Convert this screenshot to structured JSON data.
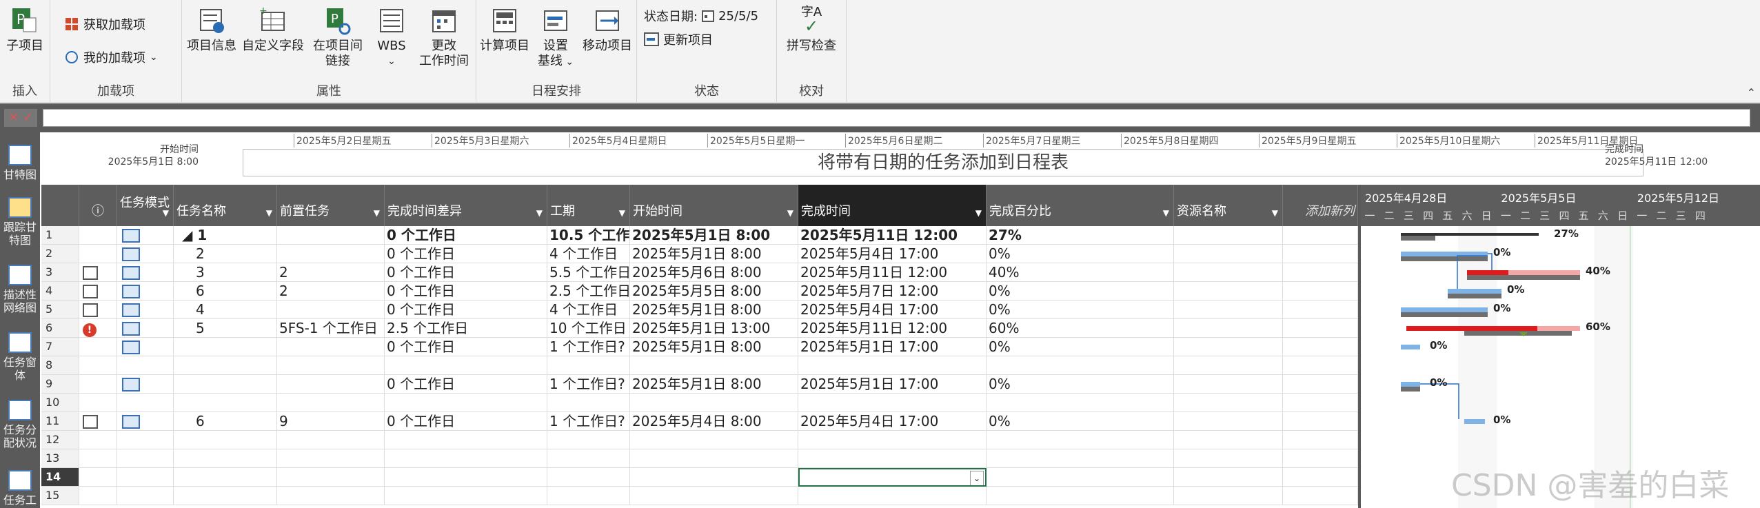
{
  "ribbon": {
    "groups": {
      "insert": {
        "label": "插入",
        "subproject": "子项目"
      },
      "addins": {
        "label": "加载项",
        "get_addins": "获取加载项",
        "my_addins": "我的加载项"
      },
      "properties": {
        "label": "属性",
        "project_info": "项目信息",
        "custom_fields": "自定义字段",
        "links_line1": "在项目间",
        "links_line2": "链接",
        "wbs": "WBS",
        "change_time_line1": "更改",
        "change_time_line2": "工作时间"
      },
      "schedule": {
        "label": "日程安排",
        "calc": "计算项目",
        "baseline_line1": "设置",
        "baseline_line2": "基线",
        "move": "移动项目"
      },
      "status": {
        "label": "状态",
        "status_date_label": "状态日期:",
        "status_date": "25/5/5",
        "update": "更新项目"
      },
      "proofing": {
        "label": "校对",
        "spell_top": "字A",
        "spell": "拼写检查"
      }
    }
  },
  "viewbar": {
    "items": [
      "甘特图",
      "跟踪甘特图",
      "描述性网络图",
      "任务窗体",
      "任务分配状况",
      "任务工"
    ]
  },
  "timeline": {
    "start_label": "开始时间",
    "start_value": "2025年5月1日 8:00",
    "finish_label": "完成时间",
    "finish_value": "2025年5月11日 12:00",
    "placeholder": "将带有日期的任务添加到日程表",
    "dates": [
      "2025年5月2日星期五",
      "2025年5月3日星期六",
      "2025年5月4日星期日",
      "2025年5月5日星期一",
      "2025年5月6日星期二",
      "2025年5月7日星期三",
      "2025年5月8日星期四",
      "2025年5月9日星期五",
      "2025年5月10日星期六",
      "2025年5月11日星期日"
    ]
  },
  "grid": {
    "headers": {
      "info": "ⓘ",
      "mode": "任务模式",
      "name": "任务名称",
      "pred": "前置任务",
      "slack": "完成时间差异",
      "duration": "工期",
      "start": "开始时间",
      "finish": "完成时间",
      "pct": "完成百分比",
      "resource": "资源名称",
      "add": "添加新列"
    },
    "rows": [
      {
        "no": "1",
        "ind": "",
        "name": "◢ 1",
        "pred": "",
        "slack": "0 个工作日",
        "dur": "10.5 个工作",
        "start": "2025年5月1日 8:00",
        "finish": "2025年5月11日 12:00",
        "pct": "27%",
        "bold": true
      },
      {
        "no": "2",
        "ind": "",
        "name": "2",
        "pred": "",
        "slack": "0 个工作日",
        "dur": "4 个工作日",
        "start": "2025年5月1日 8:00",
        "finish": "2025年5月4日 17:00",
        "pct": "0%"
      },
      {
        "no": "3",
        "ind": "cal",
        "name": "3",
        "pred": "2",
        "slack": "0 个工作日",
        "dur": "5.5 个工作日",
        "start": "2025年5月6日 8:00",
        "finish": "2025年5月11日 12:00",
        "pct": "40%"
      },
      {
        "no": "4",
        "ind": "cal",
        "name": "6",
        "pred": "2",
        "slack": "0 个工作日",
        "dur": "2.5 个工作日",
        "start": "2025年5月5日 8:00",
        "finish": "2025年5月7日 12:00",
        "pct": "0%"
      },
      {
        "no": "5",
        "ind": "cal",
        "name": "4",
        "pred": "",
        "slack": "0 个工作日",
        "dur": "4 个工作日",
        "start": "2025年5月1日 8:00",
        "finish": "2025年5月4日 17:00",
        "pct": "0%"
      },
      {
        "no": "6",
        "ind": "warn",
        "name": "5",
        "pred": "5FS-1 个工作日",
        "slack": "2.5 个工作日",
        "dur": "10 个工作日",
        "start": "2025年5月1日 13:00",
        "finish": "2025年5月11日 12:00",
        "pct": "60%"
      },
      {
        "no": "7",
        "ind": "",
        "name": "",
        "pred": "",
        "slack": "0 个工作日",
        "dur": "1 个工作日?",
        "start": "2025年5月1日 8:00",
        "finish": "2025年5月1日 17:00",
        "pct": "0%"
      },
      {
        "no": "8",
        "ind": "",
        "name": "",
        "pred": "",
        "slack": "",
        "dur": "",
        "start": "",
        "finish": "",
        "pct": "",
        "empty": true
      },
      {
        "no": "9",
        "ind": "",
        "name": "",
        "pred": "",
        "slack": "0 个工作日",
        "dur": "1 个工作日?",
        "start": "2025年5月1日 8:00",
        "finish": "2025年5月1日 17:00",
        "pct": "0%"
      },
      {
        "no": "10",
        "ind": "",
        "name": "",
        "pred": "",
        "slack": "",
        "dur": "",
        "start": "",
        "finish": "",
        "pct": "",
        "empty": true
      },
      {
        "no": "11",
        "ind": "cal",
        "name": "6",
        "pred": "9",
        "slack": "0 个工作日",
        "dur": "1 个工作日?",
        "start": "2025年5月4日 8:00",
        "finish": "2025年5月4日 17:00",
        "pct": "0%"
      },
      {
        "no": "12",
        "empty": true
      },
      {
        "no": "13",
        "empty": true
      },
      {
        "no": "14",
        "empty": true,
        "selected": true
      },
      {
        "no": "15",
        "empty": true
      }
    ]
  },
  "gantt": {
    "weeks": [
      "2025年4月28日",
      "2025年5月5日",
      "2025年5月12日"
    ],
    "days": [
      "一",
      "二",
      "三",
      "四",
      "五",
      "六",
      "日",
      "一",
      "二",
      "三",
      "四",
      "五",
      "六",
      "日",
      "一",
      "二",
      "三",
      "四"
    ],
    "pct_labels": [
      "27%",
      "0%",
      "40%",
      "0%",
      "0%",
      "60%",
      "0%",
      "0%",
      "0%"
    ]
  },
  "watermark": "CSDN @害羞的白菜",
  "colors": {
    "ribbon_bg": "#f3f3f3",
    "dark": "#5a5a5a",
    "bar_blue": "#7fb2e5",
    "bar_gray": "#6e6e6e",
    "bar_red": "#e01b1b",
    "bar_pink": "#f5a6a6",
    "link_blue": "#2f6fc8"
  }
}
